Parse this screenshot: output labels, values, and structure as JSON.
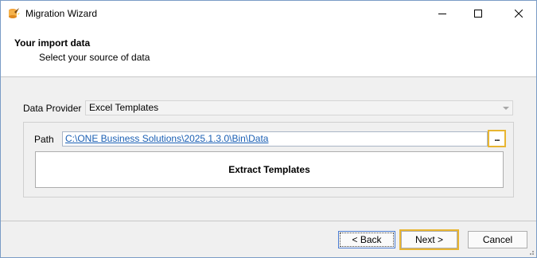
{
  "window": {
    "title": "Migration Wizard",
    "app_icon": "wizard-wand-icon",
    "controls": [
      "minimize-icon",
      "maximize-icon",
      "close-icon"
    ]
  },
  "header": {
    "title": "Your import data",
    "subtitle": "Select your source of data"
  },
  "data_provider": {
    "label": "Data Provider",
    "value": "Excel Templates"
  },
  "path": {
    "label": "Path",
    "value": "C:\\ONE Business Solutions\\2025.1.3.0\\Bin\\Data",
    "browse_label": "..."
  },
  "extract_button": {
    "label": "Extract Templates"
  },
  "footer": {
    "back_label": "< Back",
    "next_label": "Next >",
    "cancel_label": "Cancel"
  },
  "colors": {
    "highlight": "#e8b531",
    "link": "#1a5fb4",
    "window_border": "#7a9cc6"
  }
}
